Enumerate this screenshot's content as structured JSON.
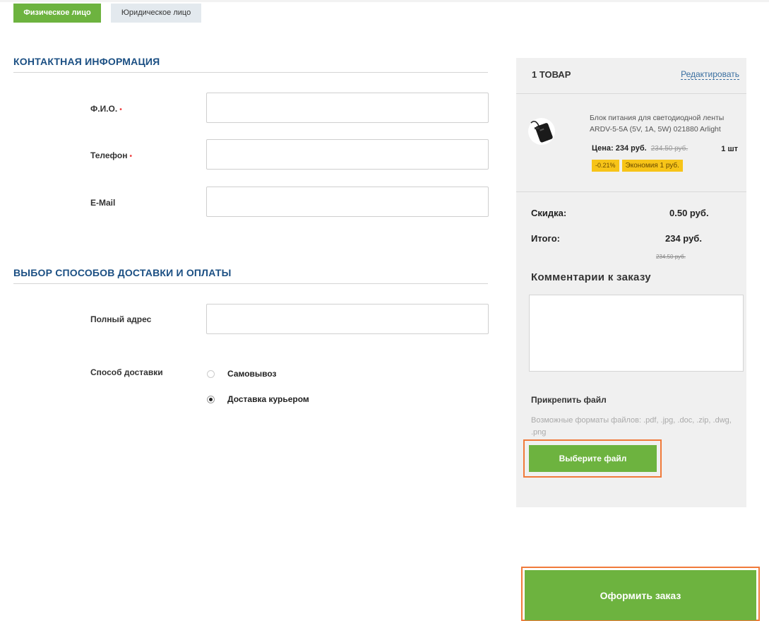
{
  "tabs": {
    "individual": "Физическое лицо",
    "company": "Юридическое лицо"
  },
  "contact": {
    "title": "КОНТАКТНАЯ ИНФОРМАЦИЯ",
    "name_label": "Ф.И.О.",
    "phone_label": "Телефон",
    "email_label": "E-Mail",
    "required_mark": "•",
    "name_value": "",
    "phone_value": "",
    "email_value": ""
  },
  "delivery": {
    "title": "ВЫБОР СПОСОБОВ ДОСТАВКИ И ОПЛАТЫ",
    "address_label": "Полный адрес",
    "address_value": "",
    "method_label": "Способ доставки",
    "options": [
      {
        "label": "Самовывоз",
        "checked": false
      },
      {
        "label": "Доставка курьером",
        "checked": true
      }
    ]
  },
  "cart": {
    "title": "1 ТОВАР",
    "edit_link": "Редактировать",
    "product": {
      "name": "Блок питания для светодиодной ленты ARDV-5-5A (5V, 1A, 5W) 021880 Arlight",
      "price": "Цена: 234 руб.",
      "old_price": "234.50 руб.",
      "quantity": "1 шт",
      "discount_badge": "-0.21%",
      "saving_badge": "Экономия 1 руб."
    },
    "discount_label": "Скидка:",
    "discount_value": "0.50 руб.",
    "total_label": "Итого:",
    "total_value": "234 руб.",
    "total_old": "234.50 руб.",
    "comment_title": "Комментарии к заказу",
    "attach_title": "Прикрепить файл",
    "attach_hint": "Возможные форматы файлов: .pdf, .jpg, .doc, .zip, .dwg, .png",
    "choose_file": "Выберите файл"
  },
  "submit_label": "Оформить заказ",
  "colors": {
    "accent_green": "#6db33f",
    "heading_blue": "#1b4f83",
    "highlight_orange": "#f07a3a",
    "badge_yellow": "#f7c418"
  }
}
